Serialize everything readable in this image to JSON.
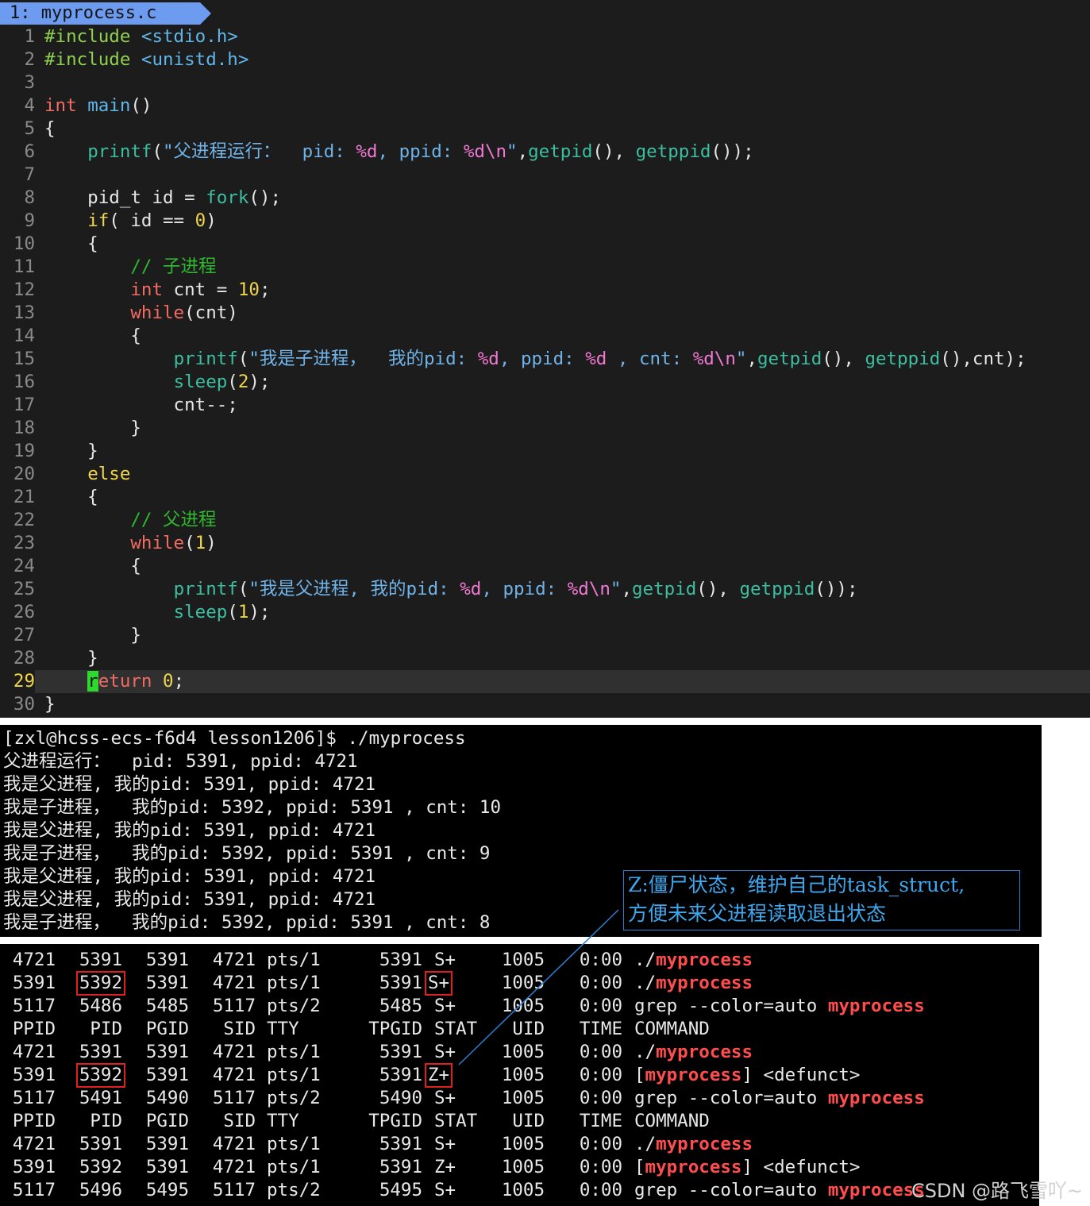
{
  "editor": {
    "tab_label": "1: myprocess.c",
    "current_line": 29,
    "lines": [
      {
        "n": "1",
        "tokens": [
          [
            "pre",
            "#include "
          ],
          [
            "hdr",
            "<stdio.h>"
          ]
        ]
      },
      {
        "n": "2",
        "tokens": [
          [
            "pre",
            "#include "
          ],
          [
            "hdr",
            "<unistd.h>"
          ]
        ]
      },
      {
        "n": "3",
        "tokens": []
      },
      {
        "n": "4",
        "tokens": [
          [
            "type",
            "int"
          ],
          [
            "plain",
            " "
          ],
          [
            "fn",
            "main"
          ],
          [
            "plain",
            "()"
          ]
        ]
      },
      {
        "n": "5",
        "tokens": [
          [
            "plain",
            "{"
          ]
        ]
      },
      {
        "n": "6",
        "tokens": [
          [
            "plain",
            "    "
          ],
          [
            "libfn",
            "printf"
          ],
          [
            "plain",
            "("
          ],
          [
            "str",
            "\"父进程运行：  pid: "
          ],
          [
            "fmt",
            "%d"
          ],
          [
            "str",
            ", ppid: "
          ],
          [
            "fmt",
            "%d\\n"
          ],
          [
            "str",
            "\""
          ],
          [
            "plain",
            ","
          ],
          [
            "libfn",
            "getpid"
          ],
          [
            "plain",
            "(), "
          ],
          [
            "libfn",
            "getppid"
          ],
          [
            "plain",
            "());"
          ]
        ]
      },
      {
        "n": "7",
        "tokens": []
      },
      {
        "n": "8",
        "tokens": [
          [
            "plain",
            "    pid_t id = "
          ],
          [
            "libfn",
            "fork"
          ],
          [
            "plain",
            "();"
          ]
        ]
      },
      {
        "n": "9",
        "tokens": [
          [
            "plain",
            "    "
          ],
          [
            "kw",
            "if"
          ],
          [
            "plain",
            "( id == "
          ],
          [
            "num",
            "0"
          ],
          [
            "plain",
            ")"
          ]
        ]
      },
      {
        "n": "10",
        "tokens": [
          [
            "plain",
            "    {"
          ]
        ]
      },
      {
        "n": "11",
        "tokens": [
          [
            "plain",
            "        "
          ],
          [
            "cmt",
            "// 子进程"
          ]
        ]
      },
      {
        "n": "12",
        "tokens": [
          [
            "plain",
            "        "
          ],
          [
            "type",
            "int"
          ],
          [
            "plain",
            " cnt = "
          ],
          [
            "num",
            "10"
          ],
          [
            "plain",
            ";"
          ]
        ]
      },
      {
        "n": "13",
        "tokens": [
          [
            "plain",
            "        "
          ],
          [
            "type",
            "while"
          ],
          [
            "plain",
            "(cnt)"
          ]
        ]
      },
      {
        "n": "14",
        "tokens": [
          [
            "plain",
            "        {"
          ]
        ]
      },
      {
        "n": "15",
        "tokens": [
          [
            "plain",
            "            "
          ],
          [
            "libfn",
            "printf"
          ],
          [
            "plain",
            "("
          ],
          [
            "str",
            "\"我是子进程，  我的pid: "
          ],
          [
            "fmt",
            "%d"
          ],
          [
            "str",
            ", ppid: "
          ],
          [
            "fmt",
            "%d"
          ],
          [
            "str",
            " , cnt: "
          ],
          [
            "fmt",
            "%d\\n"
          ],
          [
            "str",
            "\""
          ],
          [
            "plain",
            ","
          ],
          [
            "libfn",
            "getpid"
          ],
          [
            "plain",
            "(), "
          ],
          [
            "libfn",
            "getppid"
          ],
          [
            "plain",
            "(),cnt);"
          ]
        ]
      },
      {
        "n": "16",
        "tokens": [
          [
            "plain",
            "            "
          ],
          [
            "libfn",
            "sleep"
          ],
          [
            "plain",
            "("
          ],
          [
            "num",
            "2"
          ],
          [
            "plain",
            ");"
          ]
        ]
      },
      {
        "n": "17",
        "tokens": [
          [
            "plain",
            "            cnt--;"
          ]
        ]
      },
      {
        "n": "18",
        "tokens": [
          [
            "plain",
            "        }"
          ]
        ]
      },
      {
        "n": "19",
        "tokens": [
          [
            "plain",
            "    }"
          ]
        ]
      },
      {
        "n": "20",
        "tokens": [
          [
            "plain",
            "    "
          ],
          [
            "kw",
            "else"
          ]
        ]
      },
      {
        "n": "21",
        "tokens": [
          [
            "plain",
            "    {"
          ]
        ]
      },
      {
        "n": "22",
        "tokens": [
          [
            "plain",
            "        "
          ],
          [
            "cmt",
            "// 父进程"
          ]
        ]
      },
      {
        "n": "23",
        "tokens": [
          [
            "plain",
            "        "
          ],
          [
            "type",
            "while"
          ],
          [
            "plain",
            "("
          ],
          [
            "num",
            "1"
          ],
          [
            "plain",
            ")"
          ]
        ]
      },
      {
        "n": "24",
        "tokens": [
          [
            "plain",
            "        {"
          ]
        ]
      },
      {
        "n": "25",
        "tokens": [
          [
            "plain",
            "            "
          ],
          [
            "libfn",
            "printf"
          ],
          [
            "plain",
            "("
          ],
          [
            "str",
            "\"我是父进程, 我的pid: "
          ],
          [
            "fmt",
            "%d"
          ],
          [
            "str",
            ", ppid: "
          ],
          [
            "fmt",
            "%d\\n"
          ],
          [
            "str",
            "\""
          ],
          [
            "plain",
            ","
          ],
          [
            "libfn",
            "getpid"
          ],
          [
            "plain",
            "(), "
          ],
          [
            "libfn",
            "getppid"
          ],
          [
            "plain",
            "());"
          ]
        ]
      },
      {
        "n": "26",
        "tokens": [
          [
            "plain",
            "            "
          ],
          [
            "libfn",
            "sleep"
          ],
          [
            "plain",
            "("
          ],
          [
            "num",
            "1"
          ],
          [
            "plain",
            ");"
          ]
        ]
      },
      {
        "n": "27",
        "tokens": [
          [
            "plain",
            "        }"
          ]
        ]
      },
      {
        "n": "28",
        "tokens": [
          [
            "plain",
            "    }"
          ]
        ]
      },
      {
        "n": "29",
        "tokens": [
          [
            "plain",
            "    "
          ],
          [
            "cursor",
            "r"
          ],
          [
            "type",
            "eturn"
          ],
          [
            "plain",
            " "
          ],
          [
            "num",
            "0"
          ],
          [
            "plain",
            ";"
          ]
        ]
      },
      {
        "n": "30",
        "tokens": [
          [
            "plain",
            "}"
          ]
        ]
      }
    ]
  },
  "terminal_output": [
    "[zxl@hcss-ecs-f6d4 lesson1206]$ ./myprocess",
    "父进程运行：  pid: 5391, ppid: 4721",
    "我是父进程, 我的pid: 5391, ppid: 4721",
    "我是子进程，  我的pid: 5392, ppid: 5391 , cnt: 10",
    "我是父进程, 我的pid: 5391, ppid: 4721",
    "我是子进程，  我的pid: 5392, ppid: 5391 , cnt: 9",
    "我是父进程, 我的pid: 5391, ppid: 4721",
    "我是父进程, 我的pid: 5391, ppid: 4721",
    "我是子进程，  我的pid: 5392, ppid: 5391 , cnt: 8"
  ],
  "ps_table": {
    "rows": [
      {
        "ppid": "4721",
        "pid": "5391",
        "pgid": "5391",
        "sid": "4721",
        "tty": "pts/1",
        "tpgid": "5391",
        "stat": "S+",
        "uid": "1005",
        "time": "0:00",
        "cmd_pre": "./",
        "cmd_hl": "myprocess",
        "cmd_post": "",
        "pid_box": false,
        "stat_box": false
      },
      {
        "ppid": "5391",
        "pid": "5392",
        "pgid": "5391",
        "sid": "4721",
        "tty": "pts/1",
        "tpgid": "5391",
        "stat": "S+",
        "uid": "1005",
        "time": "0:00",
        "cmd_pre": "./",
        "cmd_hl": "myprocess",
        "cmd_post": "",
        "pid_box": true,
        "stat_box": true
      },
      {
        "ppid": "5117",
        "pid": "5486",
        "pgid": "5485",
        "sid": "5117",
        "tty": "pts/2",
        "tpgid": "5485",
        "stat": "S+",
        "uid": "1005",
        "time": "0:00",
        "cmd_pre": "grep --color=auto ",
        "cmd_hl": "myprocess",
        "cmd_post": "",
        "pid_box": false,
        "stat_box": false
      },
      {
        "header": true,
        "ppid": "PPID",
        "pid": "PID",
        "pgid": "PGID",
        "sid": "SID",
        "tty": "TTY",
        "tpgid": "TPGID",
        "stat": "STAT",
        "uid": "UID",
        "time": "TIME",
        "cmd_pre": "COMMAND",
        "cmd_hl": "",
        "cmd_post": ""
      },
      {
        "ppid": "4721",
        "pid": "5391",
        "pgid": "5391",
        "sid": "4721",
        "tty": "pts/1",
        "tpgid": "5391",
        "stat": "S+",
        "uid": "1005",
        "time": "0:00",
        "cmd_pre": "./",
        "cmd_hl": "myprocess",
        "cmd_post": "",
        "pid_box": false,
        "stat_box": false
      },
      {
        "ppid": "5391",
        "pid": "5392",
        "pgid": "5391",
        "sid": "4721",
        "tty": "pts/1",
        "tpgid": "5391",
        "stat": "Z+",
        "uid": "1005",
        "time": "0:00",
        "cmd_pre": "[",
        "cmd_hl": "myprocess",
        "cmd_post": "] <defunct>",
        "pid_box": true,
        "stat_box": true
      },
      {
        "ppid": "5117",
        "pid": "5491",
        "pgid": "5490",
        "sid": "5117",
        "tty": "pts/2",
        "tpgid": "5490",
        "stat": "S+",
        "uid": "1005",
        "time": "0:00",
        "cmd_pre": "grep --color=auto ",
        "cmd_hl": "myprocess",
        "cmd_post": "",
        "pid_box": false,
        "stat_box": false
      },
      {
        "header": true,
        "ppid": "PPID",
        "pid": "PID",
        "pgid": "PGID",
        "sid": "SID",
        "tty": "TTY",
        "tpgid": "TPGID",
        "stat": "STAT",
        "uid": "UID",
        "time": "TIME",
        "cmd_pre": "COMMAND",
        "cmd_hl": "",
        "cmd_post": ""
      },
      {
        "ppid": "4721",
        "pid": "5391",
        "pgid": "5391",
        "sid": "4721",
        "tty": "pts/1",
        "tpgid": "5391",
        "stat": "S+",
        "uid": "1005",
        "time": "0:00",
        "cmd_pre": "./",
        "cmd_hl": "myprocess",
        "cmd_post": "",
        "pid_box": false,
        "stat_box": false
      },
      {
        "ppid": "5391",
        "pid": "5392",
        "pgid": "5391",
        "sid": "4721",
        "tty": "pts/1",
        "tpgid": "5391",
        "stat": "Z+",
        "uid": "1005",
        "time": "0:00",
        "cmd_pre": "[",
        "cmd_hl": "myprocess",
        "cmd_post": "] <defunct>",
        "pid_box": false,
        "stat_box": false
      },
      {
        "ppid": "5117",
        "pid": "5496",
        "pgid": "5495",
        "sid": "5117",
        "tty": "pts/2",
        "tpgid": "5495",
        "stat": "S+",
        "uid": "1005",
        "time": "0:00",
        "cmd_pre": "grep --color=auto ",
        "cmd_hl": "myprocess",
        "cmd_post": "",
        "pid_box": false,
        "stat_box": false
      }
    ]
  },
  "annotation": {
    "line1": "Z:僵尸状态，维护自己的task_struct,",
    "line2": "方便未来父进程读取退出状态"
  },
  "watermark": "CSDN @路飞雪吖~",
  "colors": {
    "editor_bg": "#1c1c1c",
    "terminal_bg": "#000000",
    "highlight_red": "#ff4d4d",
    "box_red": "#e02020",
    "annotation_blue": "#3ca8f0",
    "tab_blue": "#6d9bf0"
  }
}
